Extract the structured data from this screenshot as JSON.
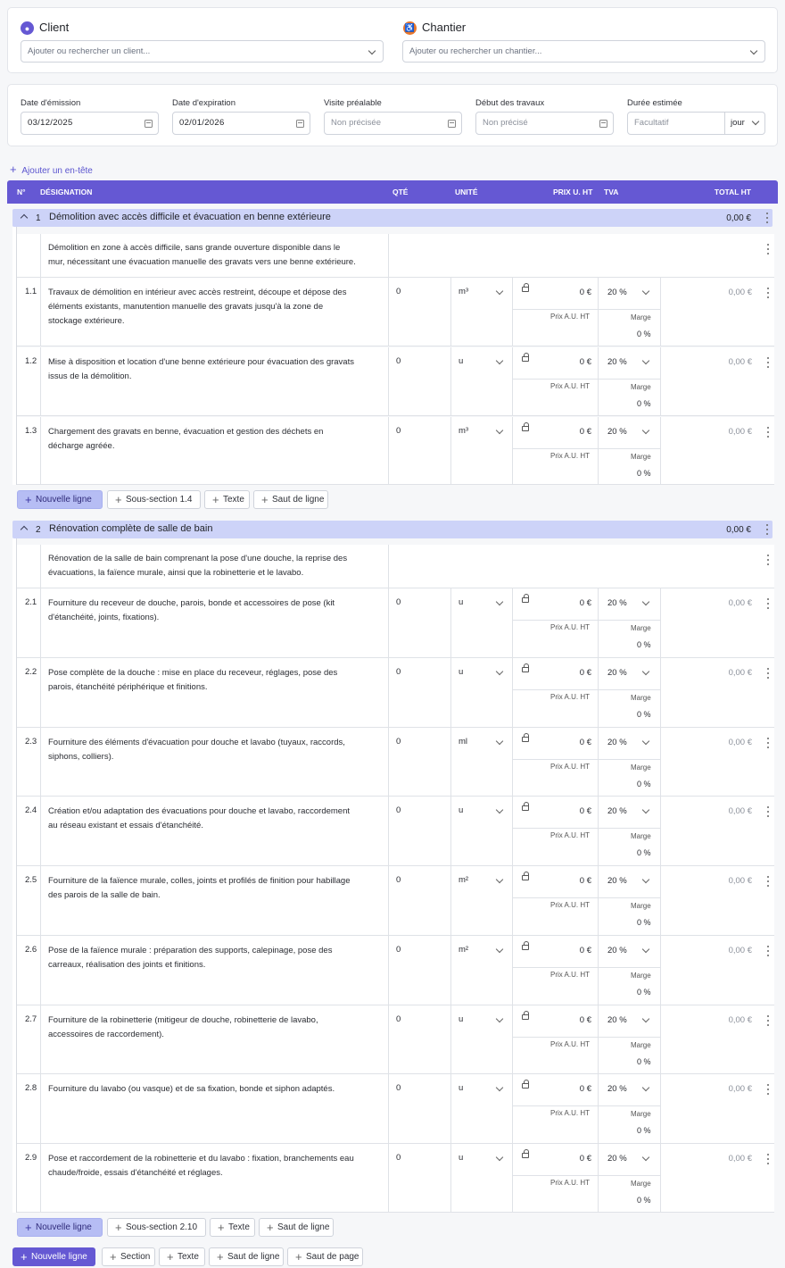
{
  "client": {
    "title": "Client",
    "placeholder": "Ajouter ou rechercher un client..."
  },
  "chantier": {
    "title": "Chantier",
    "placeholder": "Ajouter ou rechercher un chantier..."
  },
  "dates": {
    "emission_label": "Date d'émission",
    "emission_value": "03/12/2025",
    "expiration_label": "Date d'expiration",
    "expiration_value": "02/01/2026",
    "visite_label": "Visite préalable",
    "visite_value": "Non précisée",
    "debut_label": "Début des travaux",
    "debut_value": "Non précisé",
    "duree_label": "Durée estimée",
    "duree_value": "Facultatif",
    "duree_unit": "jour"
  },
  "add_header": "Ajouter un en-tête",
  "columns": {
    "num": "N°",
    "designation": "DÉSIGNATION",
    "qte": "QTÉ",
    "unite": "UNITÉ",
    "prix": "PRIX U. HT",
    "tva": "TVA",
    "total": "TOTAL HT"
  },
  "row_labels": {
    "prix_au": "Prix A.U. HT",
    "marge": "Marge"
  },
  "sections": [
    {
      "num": "1",
      "title": "Démolition avec accès difficile et évacuation en benne extérieure",
      "total": "0,00 €",
      "description": "Démolition en zone à accès difficile, sans grande ouverture disponible dans le mur, nécessitant une évacuation manuelle des gravats vers une benne extérieure.",
      "rows": [
        {
          "num": "1.1",
          "text": "Travaux de démolition en intérieur avec accès restreint, découpe et dépose des éléments existants, manutention manuelle des gravats jusqu'à la zone de stockage extérieure.",
          "qty": "0",
          "unit": "m³",
          "price": "0 €",
          "tva": "20 %",
          "marge": "0 %",
          "total": "0,00 €"
        },
        {
          "num": "1.2",
          "text": "Mise à disposition et location d'une benne extérieure pour évacuation des gravats issus de la démolition.",
          "qty": "0",
          "unit": "u",
          "price": "0 €",
          "tva": "20 %",
          "marge": "0 %",
          "total": "0,00 €"
        },
        {
          "num": "1.3",
          "text": "Chargement des gravats en benne, évacuation et gestion des déchets en décharge agréée.",
          "qty": "0",
          "unit": "m³",
          "price": "0 €",
          "tva": "20 %",
          "marge": "0 %",
          "total": "0,00 €"
        }
      ],
      "buttons": {
        "new_line": "Nouvelle ligne",
        "subsection": "Sous-section 1.4",
        "text": "Texte",
        "break": "Saut de ligne"
      }
    },
    {
      "num": "2",
      "title": "Rénovation complète de salle de bain",
      "total": "0,00 €",
      "description": "Rénovation de la salle de bain comprenant la pose d'une douche, la reprise des évacuations, la faïence murale, ainsi que la robinetterie et le lavabo.",
      "rows": [
        {
          "num": "2.1",
          "text": "Fourniture du receveur de douche, parois, bonde et accessoires de pose (kit d'étanchéité, joints, fixations).",
          "qty": "0",
          "unit": "u",
          "price": "0 €",
          "tva": "20 %",
          "marge": "0 %",
          "total": "0,00 €"
        },
        {
          "num": "2.2",
          "text": "Pose complète de la douche : mise en place du receveur, réglages, pose des parois, étanchéité périphérique et finitions.",
          "qty": "0",
          "unit": "u",
          "price": "0 €",
          "tva": "20 %",
          "marge": "0 %",
          "total": "0,00 €"
        },
        {
          "num": "2.3",
          "text": "Fourniture des éléments d'évacuation pour douche et lavabo (tuyaux, raccords, siphons, colliers).",
          "qty": "0",
          "unit": "ml",
          "price": "0 €",
          "tva": "20 %",
          "marge": "0 %",
          "total": "0,00 €"
        },
        {
          "num": "2.4",
          "text": "Création et/ou adaptation des évacuations pour douche et lavabo, raccordement au réseau existant et essais d'étanchéité.",
          "qty": "0",
          "unit": "u",
          "price": "0 €",
          "tva": "20 %",
          "marge": "0 %",
          "total": "0,00 €"
        },
        {
          "num": "2.5",
          "text": "Fourniture de la faïence murale, colles, joints et profilés de finition pour habillage des parois de la salle de bain.",
          "qty": "0",
          "unit": "m²",
          "price": "0 €",
          "tva": "20 %",
          "marge": "0 %",
          "total": "0,00 €"
        },
        {
          "num": "2.6",
          "text": "Pose de la faïence murale : préparation des supports, calepinage, pose des carreaux, réalisation des joints et finitions.",
          "qty": "0",
          "unit": "m²",
          "price": "0 €",
          "tva": "20 %",
          "marge": "0 %",
          "total": "0,00 €"
        },
        {
          "num": "2.7",
          "text": "Fourniture de la robinetterie (mitigeur de douche, robinetterie de lavabo, accessoires de raccordement).",
          "qty": "0",
          "unit": "u",
          "price": "0 €",
          "tva": "20 %",
          "marge": "0 %",
          "total": "0,00 €"
        },
        {
          "num": "2.8",
          "text": "Fourniture du lavabo (ou vasque) et de sa fixation, bonde et siphon adaptés.",
          "qty": "0",
          "unit": "u",
          "price": "0 €",
          "tva": "20 %",
          "marge": "0 %",
          "total": "0,00 €"
        },
        {
          "num": "2.9",
          "text": "Pose et raccordement de la robinetterie et du lavabo : fixation, branchements eau chaude/froide, essais d'étanchéité et réglages.",
          "qty": "0",
          "unit": "u",
          "price": "0 €",
          "tva": "20 %",
          "marge": "0 %",
          "total": "0,00 €"
        }
      ],
      "buttons": {
        "new_line": "Nouvelle ligne",
        "subsection": "Sous-section 2.10",
        "text": "Texte",
        "break": "Saut de ligne"
      }
    }
  ],
  "footer_buttons": {
    "new_line": "Nouvelle ligne",
    "section": "Section",
    "text": "Texte",
    "line_break": "Saut de ligne",
    "page_break": "Saut de page"
  },
  "colors": {
    "accent": "#6558d3",
    "section_bg": "#cdd3f8",
    "client_icon": "#6558d3",
    "chantier_icon": "#e8772e"
  },
  "icons": {
    "client": "user-icon",
    "chantier": "worker-icon",
    "date": "calendar-icon",
    "row": "lock-icon"
  }
}
